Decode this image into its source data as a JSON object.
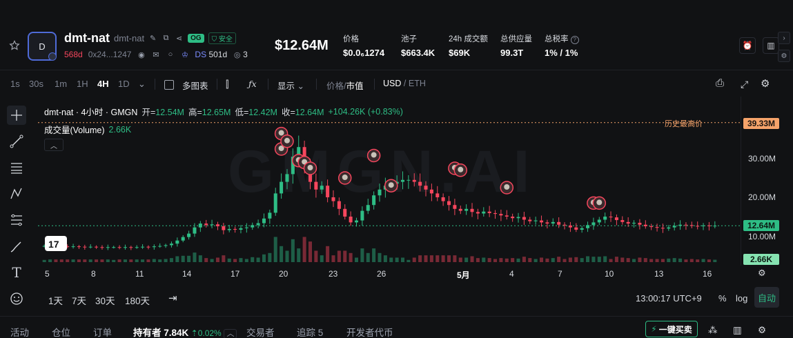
{
  "token": {
    "avatar_letter": "D",
    "name": "dmt-nat",
    "sub_name": "dmt-nat",
    "og_badge": "OG",
    "safe_badge": "安全",
    "age": "568d",
    "address": "0x24...1247",
    "ds_label": "DS",
    "ds_count": "501d",
    "watchers": "3",
    "price": "$12.64M"
  },
  "stats": [
    {
      "label": "价格",
      "value": "$0.0₆1274"
    },
    {
      "label": "池子",
      "value": "$663.4K"
    },
    {
      "label": "24h 成交额",
      "value": "$69K"
    },
    {
      "label": "总供应量",
      "value": "99.3T"
    },
    {
      "label": "总税率",
      "value": "1% / 1%"
    }
  ],
  "toolbar": {
    "timeframes": [
      "1s",
      "30s",
      "1m",
      "1H",
      "4H",
      "1D"
    ],
    "active_timeframe": "4H",
    "multi_chart": "多图表",
    "display": "显示",
    "price_label": "价格",
    "divider": "/",
    "mcap_label": "市值",
    "usd_label": "USD",
    "eth_label": "ETH"
  },
  "legend": {
    "title": "dmt-nat · 4小时 · GMGN",
    "open_label": "开=",
    "open": "12.54M",
    "high_label": "高=",
    "high": "12.65M",
    "low_label": "低=",
    "low": "12.42M",
    "close_label": "收=",
    "close": "12.64M",
    "change": "+104.26K (+0.83%)",
    "volume_label": "成交量(Volume)",
    "volume_value": "2.66K"
  },
  "watermark": "GMGN.AI",
  "ath_label": "历史最高价",
  "price_axis": {
    "ticks": [
      "30.00M",
      "20.00M",
      "10.00M"
    ],
    "ath_tag": "39.33M",
    "current_tag": "12.64M",
    "volume_tag": "2.66K"
  },
  "date_axis": {
    "ticks": [
      "5",
      "8",
      "11",
      "14",
      "17",
      "20",
      "23",
      "26",
      "5月",
      "4",
      "7",
      "10",
      "13",
      "16"
    ]
  },
  "ranges": [
    "1天",
    "7天",
    "30天",
    "180天"
  ],
  "clock": "13:00:17 UTC+9",
  "pct": "%",
  "log": "log",
  "auto": "自动",
  "bottom_tabs": {
    "activity": "活动",
    "positions": "仓位",
    "orders": "订单",
    "holders": "持有者",
    "holders_count": "7.84K",
    "holders_pct": "0.02%",
    "traders": "交易者",
    "tracking": "追踪 5",
    "dev_tokens": "开发者代币"
  },
  "buy_button": "一键买卖",
  "chart_data": {
    "type": "candlestick",
    "x_ticks": [
      "5",
      "8",
      "11",
      "14",
      "17",
      "20",
      "23",
      "26",
      "5月",
      "4",
      "7",
      "10",
      "13",
      "16"
    ],
    "ylim": [
      0,
      40000000
    ],
    "all_time_high": 39330000,
    "current": 12640000,
    "close_series": [
      7.4,
      7.5,
      7.4,
      7.3,
      7.2,
      7.3,
      7.2,
      7.1,
      7.2,
      7.1,
      7.0,
      7.1,
      7.1,
      7.0,
      7.1,
      7.0,
      7.1,
      7.2,
      7.1,
      7.3,
      7.4,
      7.6,
      8.0,
      8.8,
      9.7,
      10.6,
      12.2,
      13.2,
      12.8,
      13.0,
      12.5,
      11.5,
      11.8,
      11.6,
      12.0,
      12.2,
      12.8,
      13.3,
      14.5,
      16.0,
      21.0,
      24.0,
      26.0,
      30.5,
      33.0,
      28.0,
      24.0,
      22.0,
      23.0,
      20.0,
      19.0,
      17.0,
      15.0,
      13.5,
      14.0,
      16.5,
      18.0,
      20.5,
      22.0,
      23.0,
      23.5,
      24.0,
      24.5,
      24.5,
      24.0,
      23.0,
      22.0,
      21.0,
      20.0,
      19.0,
      18.0,
      17.0,
      16.5,
      17.0,
      16.2,
      15.8,
      16.3,
      15.9,
      15.7,
      15.3,
      15.0,
      14.6,
      14.9,
      14.2,
      13.8,
      14.0,
      13.5,
      13.2,
      13.6,
      12.9,
      12.7,
      12.2,
      11.6,
      12.0,
      12.8,
      13.5,
      14.2,
      15.0,
      14.8,
      14.1,
      13.6,
      13.2,
      13.4,
      12.9,
      12.5,
      12.3,
      12.1,
      11.9,
      12.2,
      12.6,
      12.9,
      12.8,
      12.6,
      12.5,
      12.7,
      12.6,
      12.64
    ]
  }
}
